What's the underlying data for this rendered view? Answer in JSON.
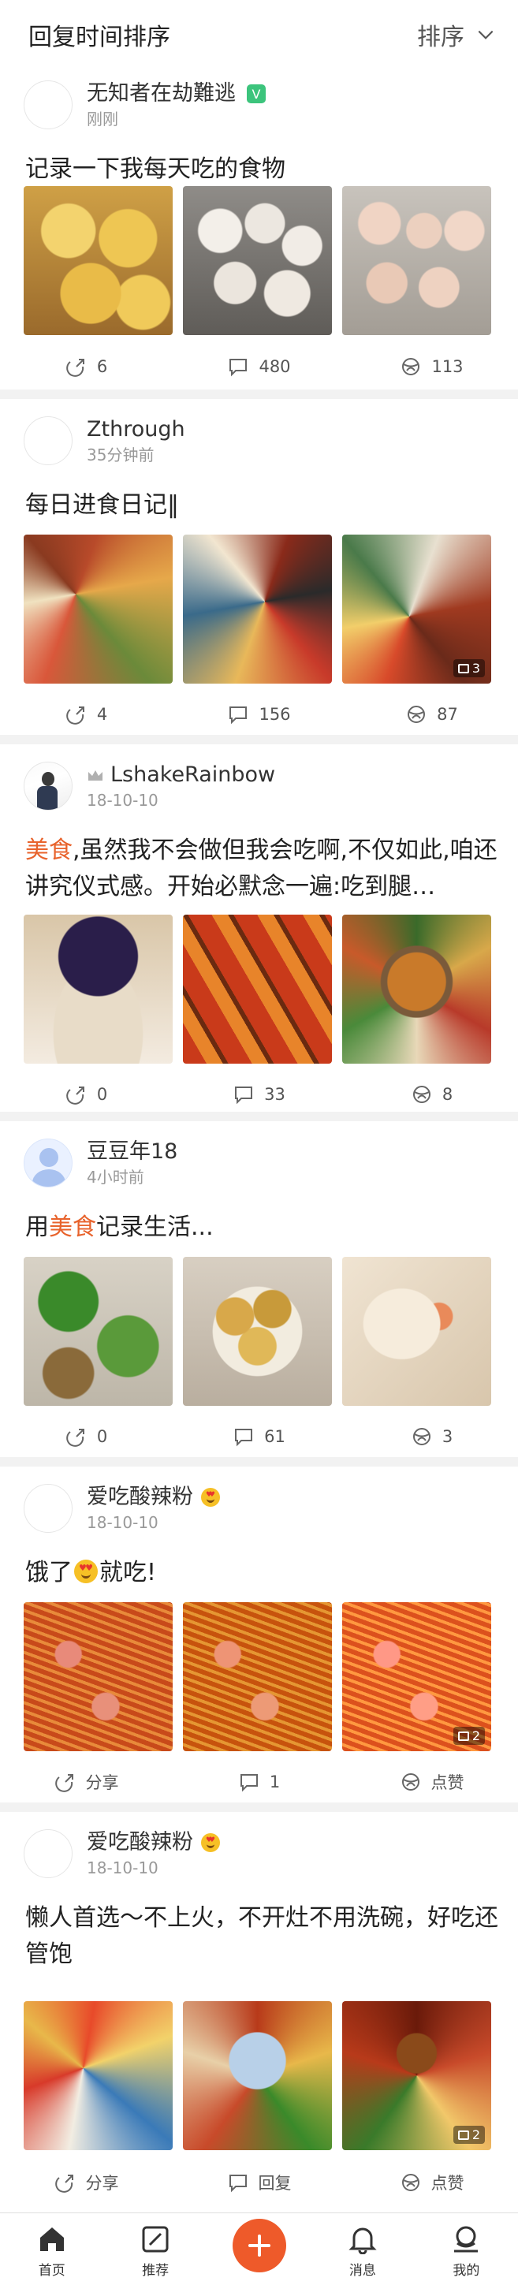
{
  "header": {
    "title": "回复时间排序",
    "sort_label": "排序"
  },
  "posts": [
    {
      "user": "无知者在劫難逃",
      "time": "刚刚",
      "verified_badge": "V",
      "text": [
        {
          "t": "记录一下我每天吃的食物",
          "hl": false
        }
      ],
      "images": [
        "steamed-buns-yellow",
        "steamed-buns-white",
        "steamed-buns-pink"
      ],
      "image_count": "",
      "actions": {
        "share": "6",
        "comment": "480",
        "like": "113"
      }
    },
    {
      "user": "Zthrough",
      "time": "35分钟前",
      "text": [
        {
          "t": "每日进食日记‖",
          "hl": false
        }
      ],
      "images": [
        "food-collage-1",
        "food-collage-2",
        "food-collage-3"
      ],
      "image_count": "3",
      "actions": {
        "share": "4",
        "comment": "156",
        "like": "87"
      }
    },
    {
      "user": "LshakeRainbow",
      "time": "18-10-10",
      "text": [
        {
          "t": "美食",
          "hl": true
        },
        {
          "t": ",虽然我不会做但我会吃啊,不仅如此,咱还讲究仪式感。开始必默念一遍:吃到腿…",
          "hl": false
        }
      ],
      "images": [
        "bubble-tea",
        "grilled-skewers",
        "hotpot-spread"
      ],
      "image_count": "",
      "actions": {
        "share": "0",
        "comment": "33",
        "like": "8"
      }
    },
    {
      "user": "豆豆年18",
      "time": "4小时前",
      "text": [
        {
          "t": "用",
          "hl": false
        },
        {
          "t": "美食",
          "hl": true
        },
        {
          "t": "记录生活...",
          "hl": false
        }
      ],
      "images": [
        "home-dishes",
        "fried-dumplings",
        "shrimp-dumplings"
      ],
      "image_count": "",
      "actions": {
        "share": "0",
        "comment": "61",
        "like": "3"
      }
    },
    {
      "user": "爱吃酸辣粉",
      "time": "18-10-10",
      "text": [
        {
          "t": "饿了",
          "hl": false
        },
        {
          "t": "[emoji]",
          "hl": false
        },
        {
          "t": "就吃!",
          "hl": false
        }
      ],
      "images": [
        "hot-sour-noodles-1",
        "hot-sour-noodles-2",
        "hot-sour-noodles-3"
      ],
      "image_count": "2",
      "actions": {
        "share": "分享",
        "comment": "1",
        "like": "点赞"
      }
    },
    {
      "user": "爱吃酸辣粉",
      "time": "18-10-10",
      "text": [
        {
          "t": "懒人首选～不上火，不开灶不用洗碗，好吃还管饱",
          "hl": false
        }
      ],
      "images": [
        "instant-noodle-pack",
        "noodle-bowl",
        "noodle-with-egg"
      ],
      "image_count": "2",
      "actions": {
        "share": "分享",
        "comment": "回复",
        "like": "点赞"
      }
    }
  ],
  "tabbar": {
    "home": "首页",
    "recommend": "推荐",
    "messages": "消息",
    "mine": "我的"
  },
  "colors": {
    "accent": "#ee5a2a",
    "highlight": "#e8632c",
    "verified": "#3cc47c"
  }
}
